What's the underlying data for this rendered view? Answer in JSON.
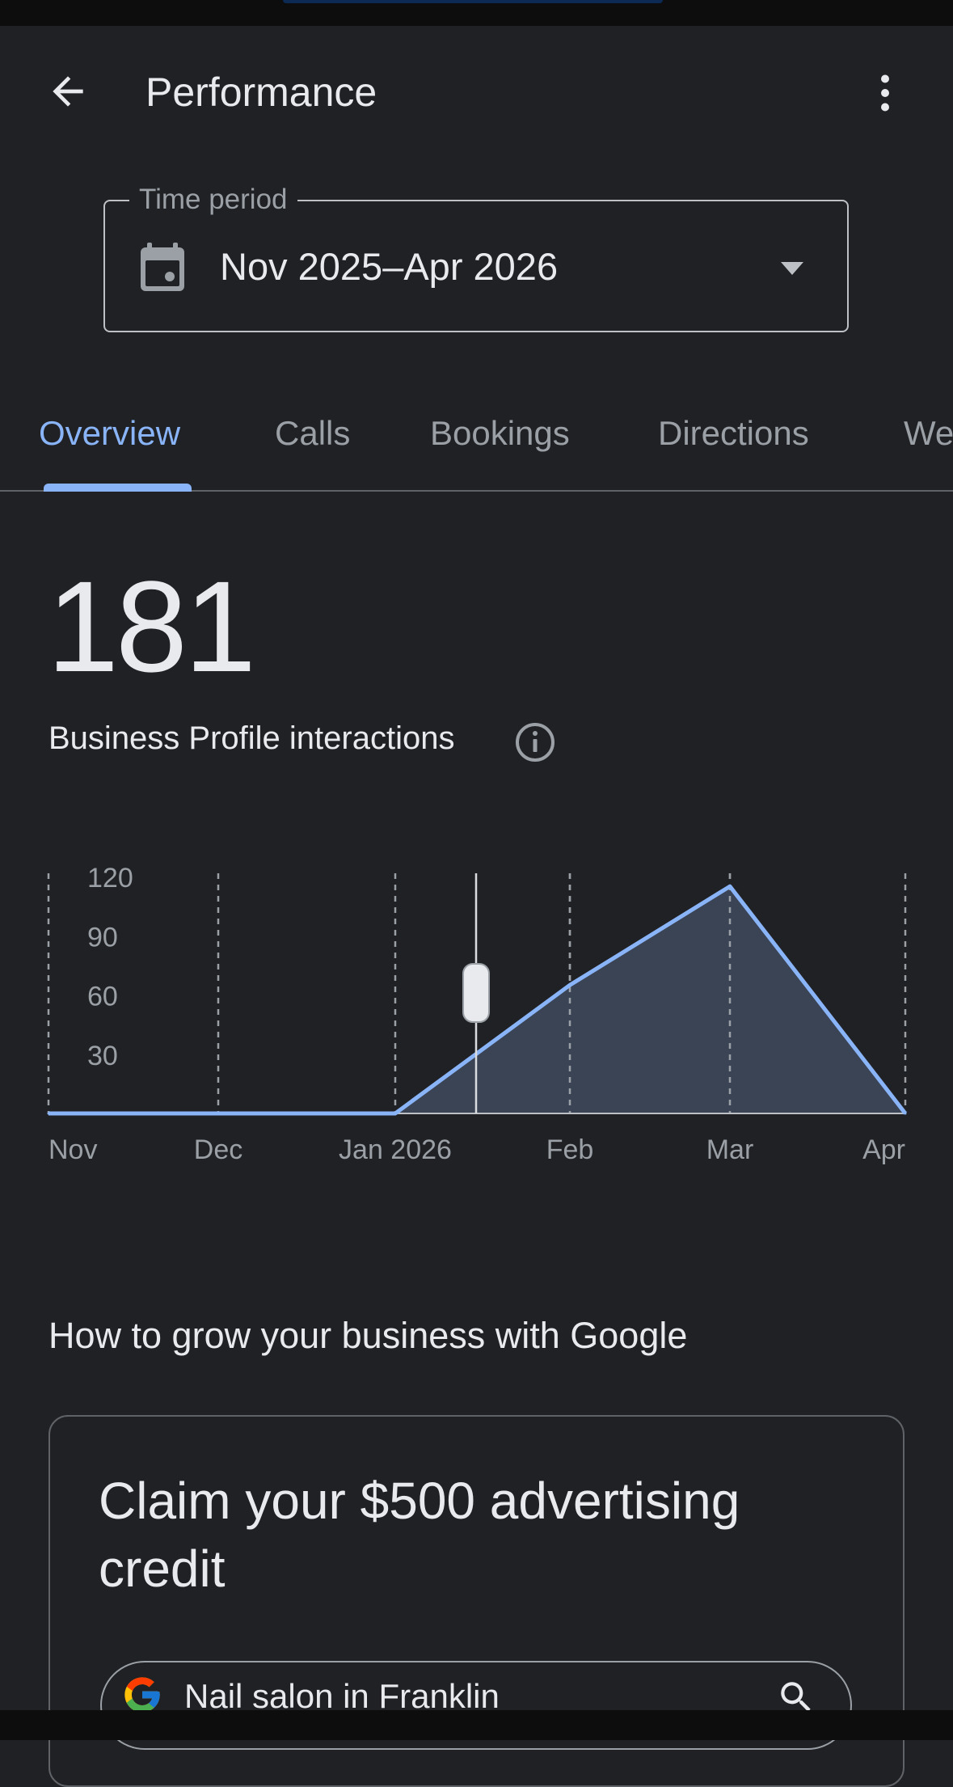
{
  "app_bar": {
    "title": "Performance",
    "back_icon": "arrow-back-icon",
    "more_icon": "more-vert-icon"
  },
  "time_period": {
    "label": "Time period",
    "value": "Nov 2025–Apr 2026",
    "icon": "calendar-icon",
    "dropdown_icon": "arrow-drop-down-icon"
  },
  "tabs": [
    {
      "label": "Overview",
      "active": true
    },
    {
      "label": "Calls",
      "active": false
    },
    {
      "label": "Bookings",
      "active": false
    },
    {
      "label": "Directions",
      "active": false
    },
    {
      "label": "We",
      "active": false
    }
  ],
  "metric": {
    "value": "181",
    "label": "Business Profile interactions",
    "info_icon": "info-icon"
  },
  "chart_data": {
    "type": "area",
    "x": [
      "Nov",
      "Dec",
      "Jan 2026",
      "Feb",
      "Mar",
      "Apr"
    ],
    "y_ticks": [
      "120",
      "90",
      "60",
      "30"
    ],
    "ylim": [
      0,
      120
    ],
    "series": [
      {
        "values": [
          0,
          0,
          0,
          65,
          115,
          0
        ]
      }
    ],
    "grid": "vertical dashed",
    "line_color": "#8ab4f8",
    "fill_color": "#3c4759",
    "scrubber": "between Jan 2026 and Feb"
  },
  "section": {
    "title": "How to grow your business with Google"
  },
  "promo_card": {
    "title": "Claim your $500 advertising credit",
    "search_text": "Nail salon in Franklin",
    "search_icon": "search-icon",
    "logo": "google-g-logo"
  },
  "colors": {
    "background": "#202124",
    "accent": "#8ab4f8",
    "text_primary": "#e8eaed",
    "text_secondary": "#9aa0a6"
  }
}
